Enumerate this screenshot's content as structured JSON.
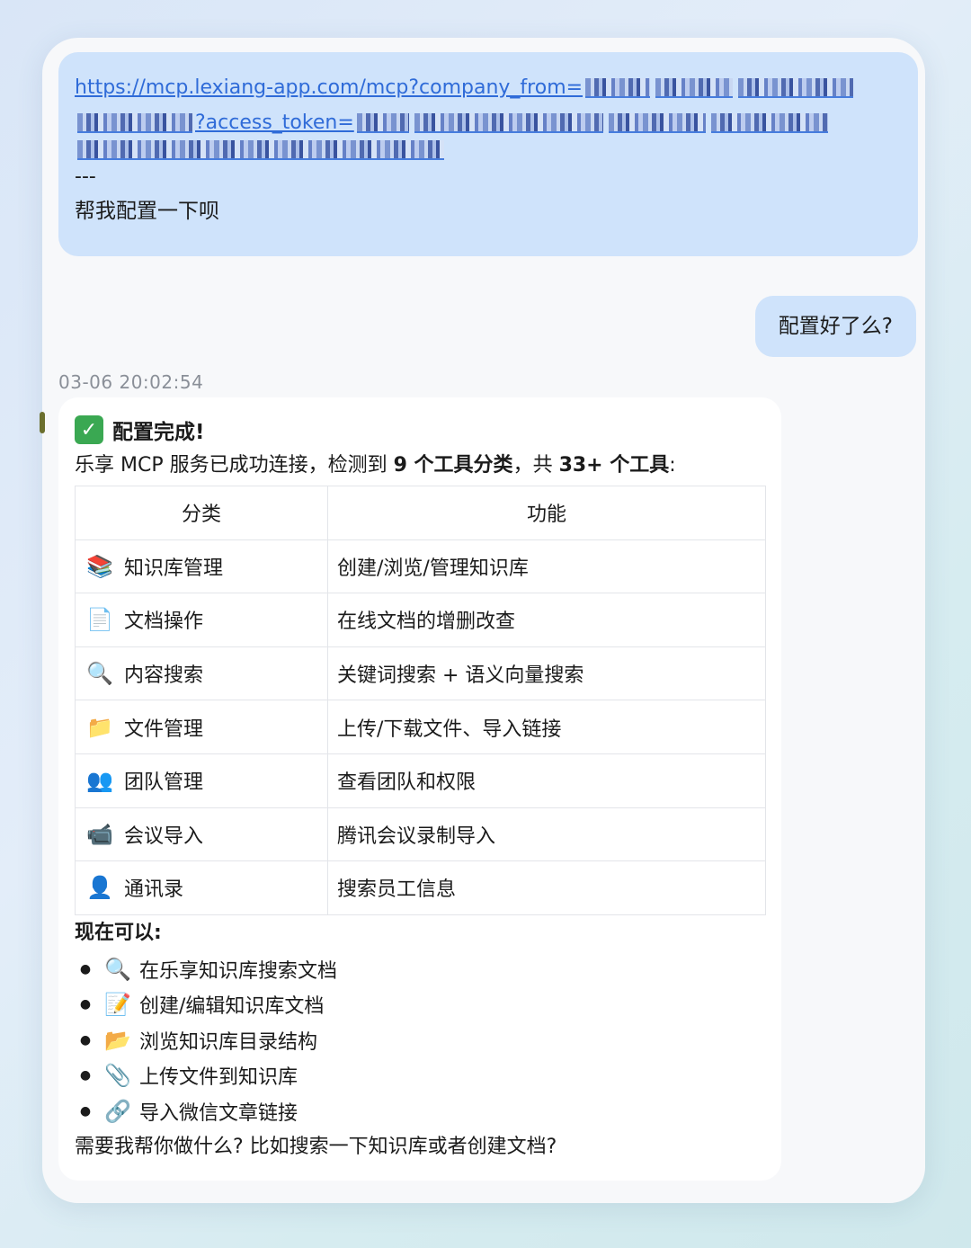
{
  "user_message_1": {
    "url_part1": "https://mcp.lexiang-app.com/mcp?company_from=",
    "url_part2": "?access_token=",
    "separator": "---",
    "request": "帮我配置一下呗"
  },
  "user_message_2": {
    "text": "配置好了么?"
  },
  "timestamp": "03-06 20:02:54",
  "reply": {
    "title_icon": "check-mark-icon",
    "title": "配置完成!",
    "summary_pre": "乐享 MCP 服务已成功连接，检测到 ",
    "summary_bold1": "9 个工具分类",
    "summary_mid": "，共 ",
    "summary_bold2": "33+ 个工具",
    "summary_post": ":",
    "table": {
      "headers": [
        "分类",
        "功能"
      ],
      "rows": [
        {
          "icon": "📚",
          "icon_name": "books-icon",
          "category": "知识库管理",
          "function": "创建/浏览/管理知识库"
        },
        {
          "icon": "📄",
          "icon_name": "document-icon",
          "category": "文档操作",
          "function": "在线文档的增删改查"
        },
        {
          "icon": "🔍",
          "icon_name": "magnifier-icon",
          "category": "内容搜索",
          "function": "关键词搜索 + 语义向量搜索"
        },
        {
          "icon": "📁",
          "icon_name": "folder-icon",
          "category": "文件管理",
          "function": "上传/下载文件、导入链接"
        },
        {
          "icon": "👥",
          "icon_name": "team-icon",
          "category": "团队管理",
          "function": "查看团队和权限"
        },
        {
          "icon": "📹",
          "icon_name": "video-camera-icon",
          "category": "会议导入",
          "function": "腾讯会议录制导入"
        },
        {
          "icon": "👤",
          "icon_name": "person-icon",
          "category": "通讯录",
          "function": "搜索员工信息"
        }
      ]
    },
    "now_title": "现在可以:",
    "capabilities": [
      {
        "icon": "🔍",
        "icon_name": "magnifier-icon",
        "text": "在乐享知识库搜索文档"
      },
      {
        "icon": "📝",
        "icon_name": "memo-icon",
        "text": "创建/编辑知识库文档"
      },
      {
        "icon": "📂",
        "icon_name": "open-folder-icon",
        "text": "浏览知识库目录结构"
      },
      {
        "icon": "📎",
        "icon_name": "paperclip-icon",
        "text": "上传文件到知识库"
      },
      {
        "icon": "🔗",
        "icon_name": "link-icon",
        "text": "导入微信文章链接"
      }
    ],
    "closing": "需要我帮你做什么? 比如搜索一下知识库或者创建文档?"
  }
}
